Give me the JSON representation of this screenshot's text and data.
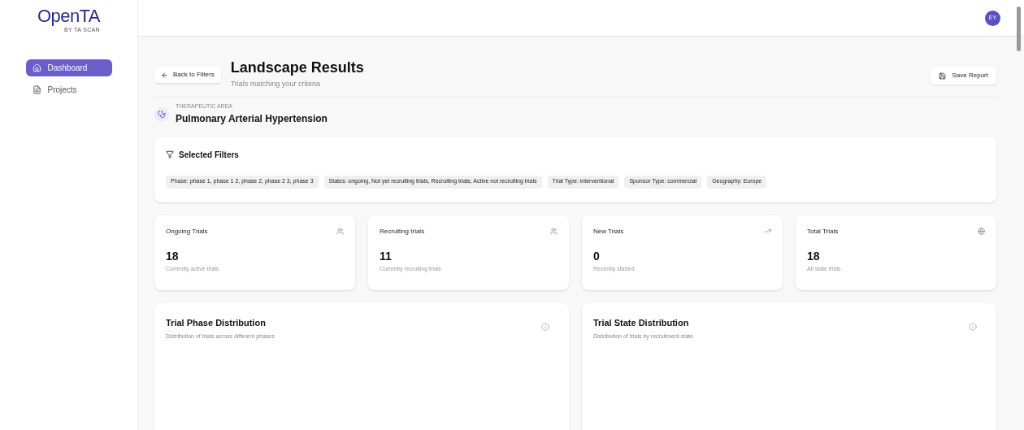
{
  "logo": {
    "name": "OpenTA",
    "tagline": "BY TA SCAN"
  },
  "sidebar": {
    "items": [
      {
        "label": "Dashboard",
        "selected": true
      },
      {
        "label": "Projects",
        "selected": false
      }
    ]
  },
  "header": {
    "avatar": "EY"
  },
  "page": {
    "back_button": "Back to Filters",
    "title": "Landscape Results",
    "subtitle": "Trials matching your criteria",
    "save_button": "Save Report"
  },
  "therapeutic_area": {
    "label": "THERAPEUTIC AREA",
    "value": "Pulmonary Arterial Hypertension"
  },
  "filters": {
    "title": "Selected Filters",
    "tags": [
      "Phase: phase 1, phase 1 2, phase 2, phase 2 3, phase 3",
      "States: ongoing, Not yet recruiting trials, Recruiting trials, Active not recruiting trials",
      "Trial Type: interventional",
      "Sponsor Type: commercial",
      "Geography: Europe"
    ]
  },
  "stats": [
    {
      "title": "Ongoing Trials",
      "value": "18",
      "caption": "Currently active trials"
    },
    {
      "title": "Recruiting trials",
      "value": "11",
      "caption": "Currently recruiting trials"
    },
    {
      "title": "New Trials",
      "value": "0",
      "caption": "Recently started"
    },
    {
      "title": "Total Trials",
      "value": "18",
      "caption": "All state trials"
    }
  ],
  "panels": [
    {
      "title": "Trial Phase Distribution",
      "subtitle": "Distribution of trials across different phases"
    },
    {
      "title": "Trial State Distribution",
      "subtitle": "Distribution of trials by recruitment state"
    }
  ]
}
